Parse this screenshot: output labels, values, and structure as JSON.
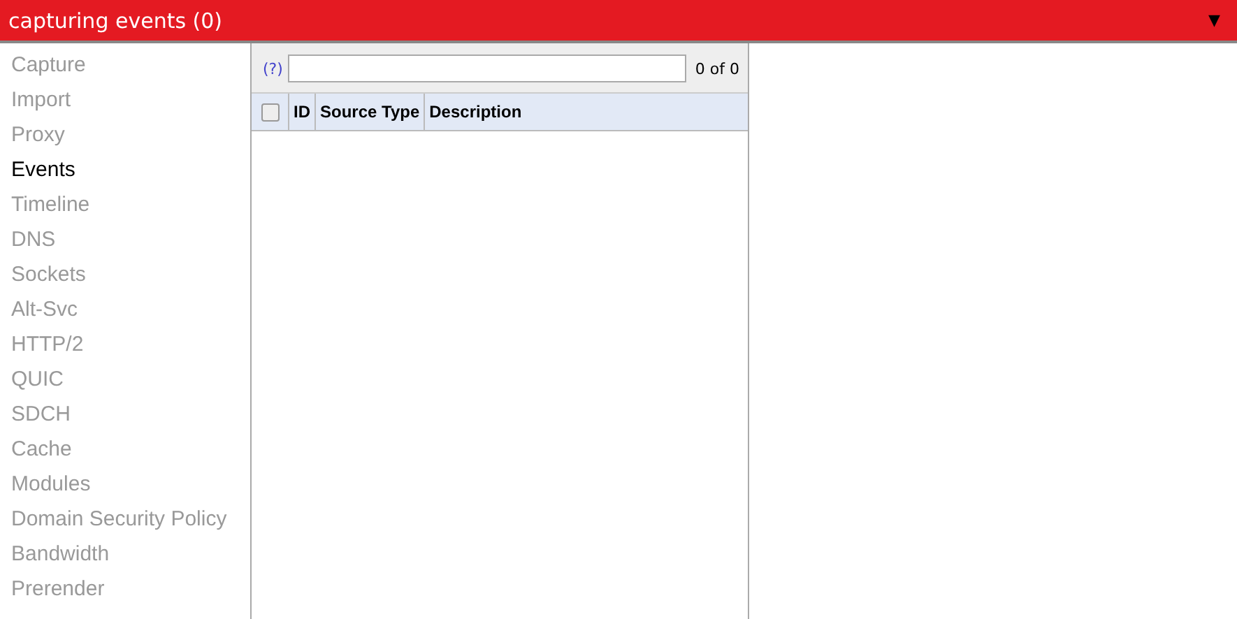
{
  "status_bar": {
    "title": "capturing events (0)",
    "menu_glyph": "▼"
  },
  "sidebar": {
    "items": [
      {
        "label": "Capture",
        "selected": false
      },
      {
        "label": "Import",
        "selected": false
      },
      {
        "label": "Proxy",
        "selected": false
      },
      {
        "label": "Events",
        "selected": true
      },
      {
        "label": "Timeline",
        "selected": false
      },
      {
        "label": "DNS",
        "selected": false
      },
      {
        "label": "Sockets",
        "selected": false
      },
      {
        "label": "Alt-Svc",
        "selected": false
      },
      {
        "label": "HTTP/2",
        "selected": false
      },
      {
        "label": "QUIC",
        "selected": false
      },
      {
        "label": "SDCH",
        "selected": false
      },
      {
        "label": "Cache",
        "selected": false
      },
      {
        "label": "Modules",
        "selected": false
      },
      {
        "label": "Domain Security Policy",
        "selected": false
      },
      {
        "label": "Bandwidth",
        "selected": false
      },
      {
        "label": "Prerender",
        "selected": false
      }
    ]
  },
  "filter": {
    "help": "(?)",
    "count": "0 of 0"
  },
  "table": {
    "select_all": {
      "checked": false
    },
    "columns": [
      "ID",
      "Source Type",
      "Description"
    ]
  }
}
